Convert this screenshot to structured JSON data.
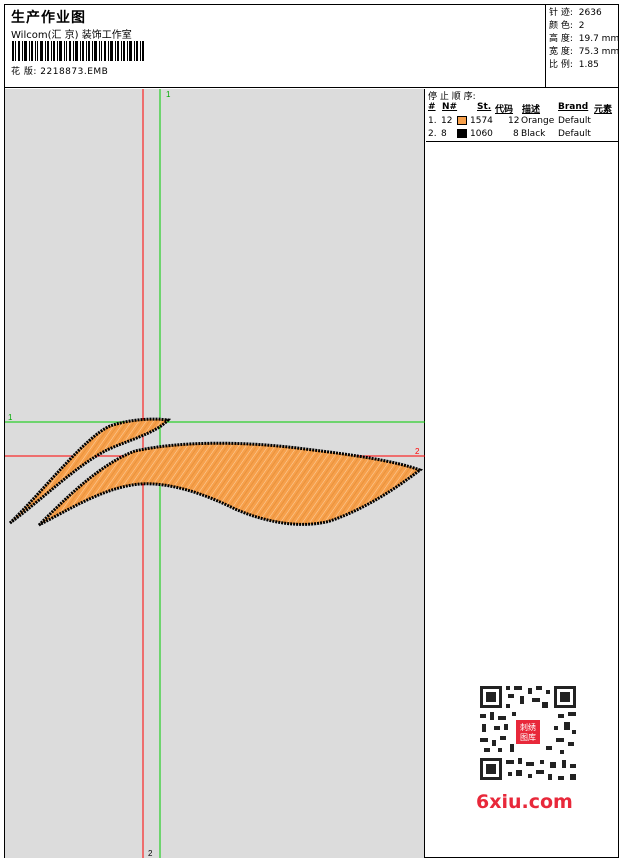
{
  "header": {
    "title": "生产作业图",
    "studio": "Wilcom(汇 京) 装饰工作室",
    "design_label": "花 版:",
    "design_file": "2218873.EMB"
  },
  "stats": {
    "stitches_label": "针 迹:",
    "stitches": "2636",
    "colors_label": "颜 色:",
    "colors": "2",
    "height_label": "高 度:",
    "height": "19.7 mm",
    "width_label": "宽 度:",
    "width": "75.3 mm",
    "scale_label": "比 例:",
    "scale": "1.85"
  },
  "stop_sequence": {
    "title": "停 止 顺 序:",
    "headers": [
      "#",
      "N#",
      "St.",
      "代码",
      "描述",
      "Brand",
      "元素"
    ],
    "rows": [
      {
        "index": "1.",
        "needle": "12",
        "code": "1574",
        "stitches": "12",
        "description": "Orange",
        "brand": "Default",
        "color": "#f7a04b"
      },
      {
        "index": "2.",
        "needle": "8",
        "code": "1060",
        "stitches": "8",
        "description": "Black",
        "brand": "Default",
        "color": "#000000"
      }
    ]
  },
  "guides": {
    "marker_1": "1",
    "marker_2": "2"
  },
  "watermark": {
    "site": "6xiu.com",
    "stamp_top": "刺绣",
    "stamp_bottom": "图库"
  },
  "colors": {
    "canvas_bg": "#dcdcdc",
    "guide_red": "#ff0000",
    "guide_green": "#00cc00",
    "thread_orange": "#f7a04b",
    "thread_black": "#000000"
  }
}
